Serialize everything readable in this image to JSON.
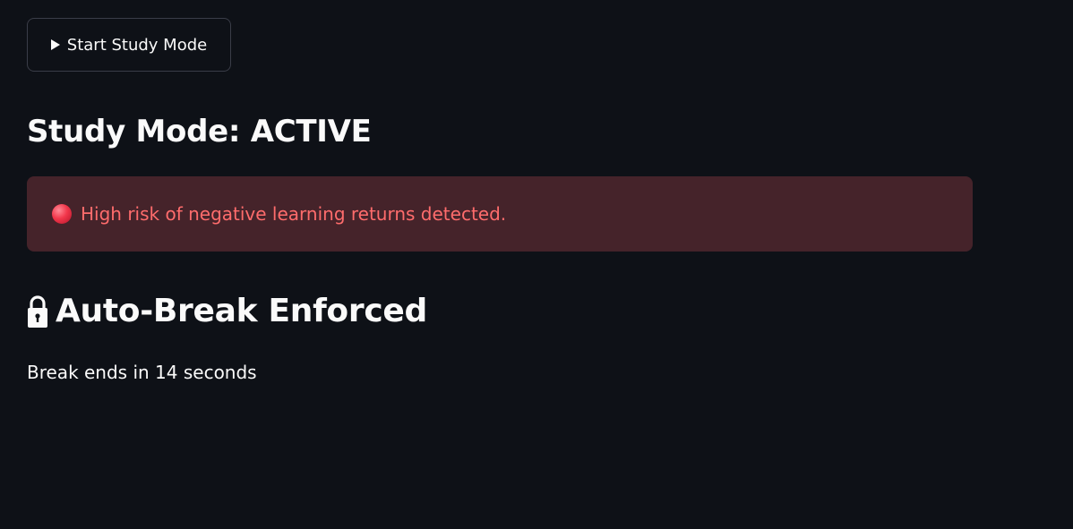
{
  "controls": {
    "start_button_label": "Start Study Mode"
  },
  "status": {
    "title": "Study Mode: ACTIVE"
  },
  "alert": {
    "message": "High risk of negative learning returns detected.",
    "icon": "red-circle-icon",
    "background_color": "#45232a",
    "text_color": "#ff6c6c"
  },
  "break_section": {
    "heading": "Auto-Break Enforced",
    "icon": "lock-icon",
    "countdown_text": "Break ends in 14 seconds"
  },
  "theme": {
    "background": "#0e1117",
    "text": "#fafafa",
    "button_border": "#3a3d48"
  }
}
